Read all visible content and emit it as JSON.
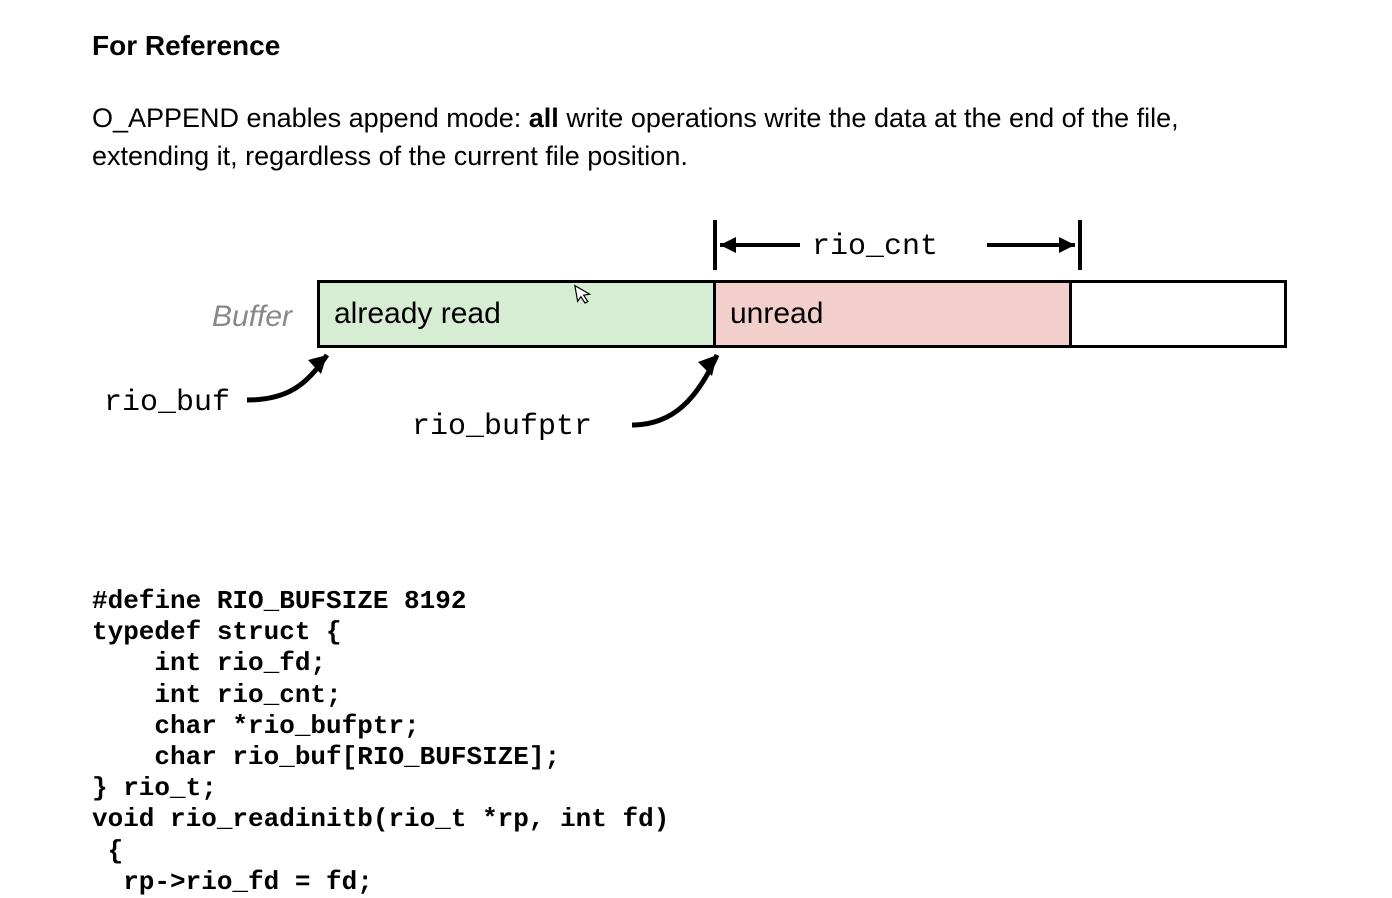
{
  "heading": "For Reference",
  "paragraph": {
    "pre": "O_APPEND enables append mode: ",
    "bold": "all",
    "post": " write operations write the data at the end of the file, extending it, regardless of the current file position."
  },
  "diagram": {
    "buffer_label": "Buffer",
    "already_read": "already read",
    "unread": "unread",
    "rio_cnt": "rio_cnt",
    "rio_buf": "rio_buf",
    "rio_bufptr": "rio_bufptr"
  },
  "code": "#define RIO_BUFSIZE 8192\ntypedef struct {\n    int rio_fd;\n    int rio_cnt;\n    char *rio_bufptr;\n    char rio_buf[RIO_BUFSIZE];\n} rio_t;\nvoid rio_readinitb(rio_t *rp, int fd)\n {\n  rp->rio_fd = fd;",
  "colors": {
    "already_bg": "#d6ecd3",
    "unread_bg": "#f3cfcb"
  }
}
